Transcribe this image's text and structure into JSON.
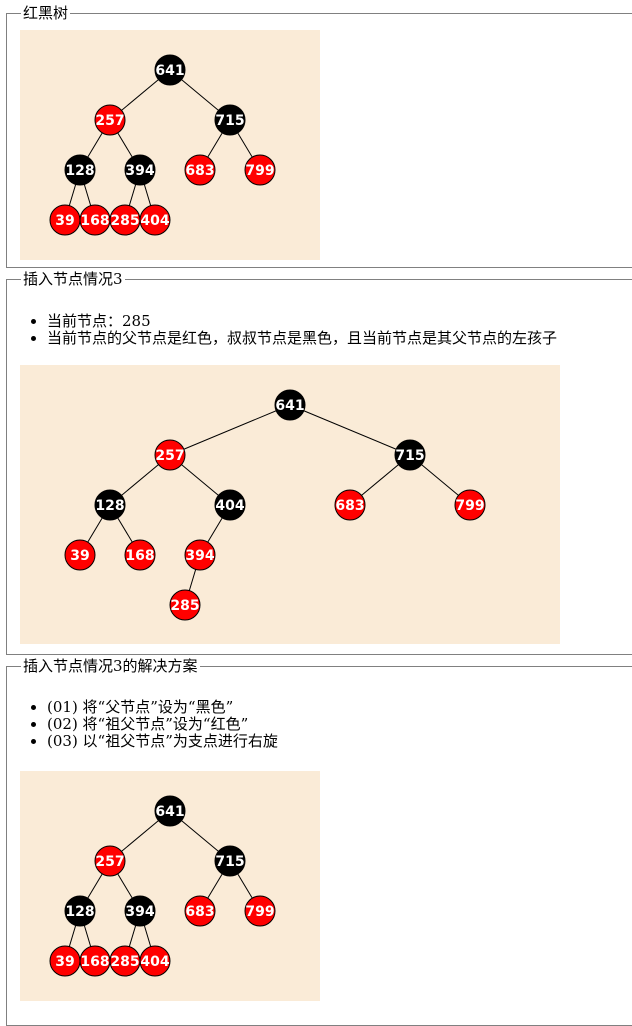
{
  "sections": [
    {
      "legend": "红黑树",
      "bullets": [],
      "nodes": [
        {
          "id": "n641",
          "value": "641",
          "color": "black"
        },
        {
          "id": "n257",
          "value": "257",
          "color": "red"
        },
        {
          "id": "n715",
          "value": "715",
          "color": "black"
        },
        {
          "id": "n128",
          "value": "128",
          "color": "black"
        },
        {
          "id": "n394",
          "value": "394",
          "color": "black"
        },
        {
          "id": "n683",
          "value": "683",
          "color": "red"
        },
        {
          "id": "n799",
          "value": "799",
          "color": "red"
        },
        {
          "id": "n39",
          "value": "39",
          "color": "red"
        },
        {
          "id": "n168",
          "value": "168",
          "color": "red"
        },
        {
          "id": "n285",
          "value": "285",
          "color": "red"
        },
        {
          "id": "n404",
          "value": "404",
          "color": "red"
        }
      ],
      "edges": [
        [
          "n641",
          "n257"
        ],
        [
          "n641",
          "n715"
        ],
        [
          "n257",
          "n128"
        ],
        [
          "n257",
          "n394"
        ],
        [
          "n715",
          "n683"
        ],
        [
          "n715",
          "n799"
        ],
        [
          "n128",
          "n39"
        ],
        [
          "n128",
          "n168"
        ],
        [
          "n394",
          "n285"
        ],
        [
          "n394",
          "n404"
        ]
      ]
    },
    {
      "legend": "插入节点情况3",
      "bullets": [
        "当前节点：285",
        "当前节点的父节点是红色，叔叔节点是黑色，且当前节点是其父节点的左孩子"
      ],
      "nodes": [
        {
          "id": "n641",
          "value": "641",
          "color": "black"
        },
        {
          "id": "n257",
          "value": "257",
          "color": "red"
        },
        {
          "id": "n715",
          "value": "715",
          "color": "black"
        },
        {
          "id": "n128",
          "value": "128",
          "color": "black"
        },
        {
          "id": "n404",
          "value": "404",
          "color": "black"
        },
        {
          "id": "n683",
          "value": "683",
          "color": "red"
        },
        {
          "id": "n799",
          "value": "799",
          "color": "red"
        },
        {
          "id": "n39",
          "value": "39",
          "color": "red"
        },
        {
          "id": "n168",
          "value": "168",
          "color": "red"
        },
        {
          "id": "n394",
          "value": "394",
          "color": "red"
        },
        {
          "id": "n285",
          "value": "285",
          "color": "red"
        }
      ],
      "edges": [
        [
          "n641",
          "n257"
        ],
        [
          "n641",
          "n715"
        ],
        [
          "n257",
          "n128"
        ],
        [
          "n257",
          "n404"
        ],
        [
          "n715",
          "n683"
        ],
        [
          "n715",
          "n799"
        ],
        [
          "n128",
          "n39"
        ],
        [
          "n128",
          "n168"
        ],
        [
          "n404",
          "n394"
        ],
        [
          "n394",
          "n285"
        ]
      ]
    },
    {
      "legend": "插入节点情况3的解决方案",
      "bullets": [
        "(01) 将“父节点”设为“黑色”",
        "(02) 将“祖父节点”设为“红色”",
        "(03) 以“祖父节点”为支点进行右旋"
      ],
      "nodes": [
        {
          "id": "n641",
          "value": "641",
          "color": "black"
        },
        {
          "id": "n257",
          "value": "257",
          "color": "red"
        },
        {
          "id": "n715",
          "value": "715",
          "color": "black"
        },
        {
          "id": "n128",
          "value": "128",
          "color": "black"
        },
        {
          "id": "n394",
          "value": "394",
          "color": "black"
        },
        {
          "id": "n683",
          "value": "683",
          "color": "red"
        },
        {
          "id": "n799",
          "value": "799",
          "color": "red"
        },
        {
          "id": "n39",
          "value": "39",
          "color": "red"
        },
        {
          "id": "n168",
          "value": "168",
          "color": "red"
        },
        {
          "id": "n285",
          "value": "285",
          "color": "red"
        },
        {
          "id": "n404",
          "value": "404",
          "color": "red"
        }
      ],
      "edges": [
        [
          "n641",
          "n257"
        ],
        [
          "n641",
          "n715"
        ],
        [
          "n257",
          "n128"
        ],
        [
          "n257",
          "n394"
        ],
        [
          "n715",
          "n683"
        ],
        [
          "n715",
          "n799"
        ],
        [
          "n128",
          "n39"
        ],
        [
          "n128",
          "n168"
        ],
        [
          "n394",
          "n285"
        ],
        [
          "n394",
          "n404"
        ]
      ]
    }
  ],
  "colors": {
    "black": "#000000",
    "red": "#ff0000",
    "canvas": "#faebd7"
  }
}
